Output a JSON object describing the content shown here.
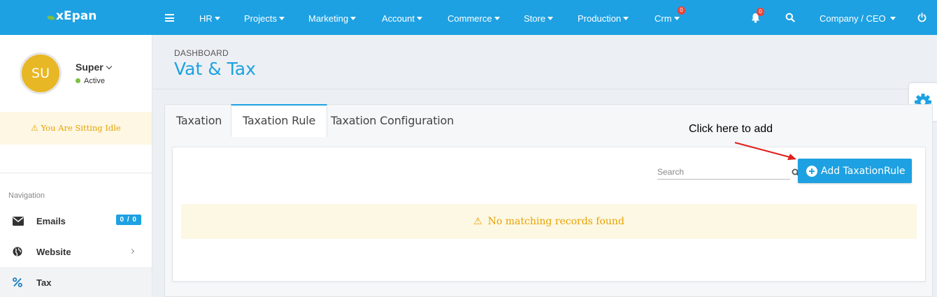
{
  "app": {
    "logo_text": "xEpan"
  },
  "topnav": {
    "items": [
      {
        "label": "HR"
      },
      {
        "label": "Projects"
      },
      {
        "label": "Marketing"
      },
      {
        "label": "Account"
      },
      {
        "label": "Commerce"
      },
      {
        "label": "Store"
      },
      {
        "label": "Production"
      },
      {
        "label": "Crm",
        "badge": "0"
      }
    ],
    "notification_badge": "0",
    "company_menu": "Company / CEO",
    "icons": [
      "menu-icon",
      "bell-icon",
      "search-icon",
      "power-icon"
    ]
  },
  "user": {
    "initials": "SU",
    "name": "Super",
    "status": "Active"
  },
  "sidebar": {
    "idle_message": "You Are Sitting Idle",
    "nav_heading": "Navigation",
    "items": [
      {
        "label": "Emails",
        "badge": "0 / 0",
        "icon": "envelope-icon"
      },
      {
        "label": "Website",
        "icon": "globe-icon"
      },
      {
        "label": "Tax",
        "icon": "percent-icon"
      }
    ]
  },
  "header": {
    "breadcrumb": "DASHBOARD",
    "title": "Vat & Tax"
  },
  "tabs": [
    {
      "label": "Taxation"
    },
    {
      "label": "Taxation Rule",
      "active": true
    },
    {
      "label": "Taxation Configuration"
    }
  ],
  "grid": {
    "search_placeholder": "Search",
    "add_button": "Add TaxationRule",
    "empty_message": "No matching records found"
  },
  "annotation": {
    "text": "Click here to add"
  },
  "colors": {
    "primary": "#1da1e2",
    "warning": "#e8a200",
    "badge": "#e5453b",
    "annotation_arrow": "#e0201b"
  }
}
